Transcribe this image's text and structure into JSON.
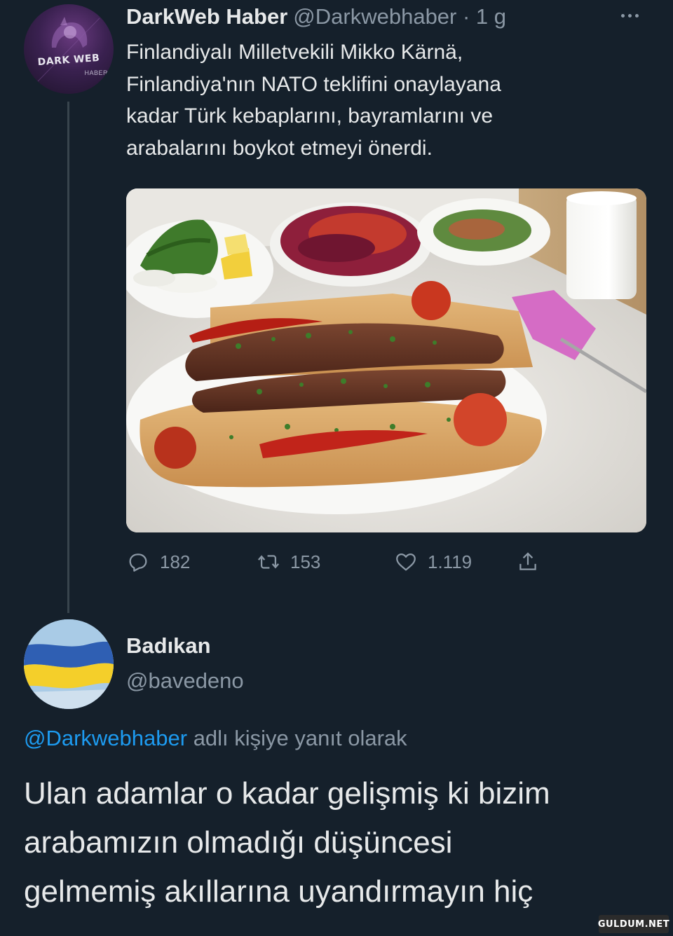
{
  "tweet": {
    "author_name": "DarkWeb Haber",
    "handle_time": "@Darkwebhaber · 1 g",
    "avatar_text": "DARK WEB",
    "avatar_subtext": "HABER",
    "lines": [
      "Finlandiyalı Milletvekili Mikko Kärnä,",
      "Finlandiya'nın NATO teklifini onaylayana",
      "kadar Türk kebaplarını, bayramlarını ve",
      "arabalarını boykot etmeyi önerdi."
    ],
    "image_alt": "Adana kebap tabağı",
    "actions": {
      "replies": "182",
      "retweets": "153",
      "likes": "1.119"
    },
    "icons": [
      "more-icon",
      "reply-icon",
      "retweet-icon",
      "like-icon",
      "share-icon"
    ]
  },
  "reply": {
    "author_name": "Badıkan",
    "handle": "@bavedeno",
    "reply_to_handle": "@Darkwebhaber",
    "reply_to_suffix": " adlı kişiye yanıt olarak",
    "lines": [
      "Ulan adamlar o kadar gelişmiş ki bizim",
      "arabamızın olmadığı düşüncesi",
      "gelmemiş akıllarına uyandırmayın hiç"
    ]
  },
  "watermark": "GULDUM.NET",
  "colors": {
    "background": "#15202b",
    "text": "#e7e9ea",
    "muted": "#8b98a5",
    "link": "#1d9bf0",
    "divider": "#38444d"
  }
}
